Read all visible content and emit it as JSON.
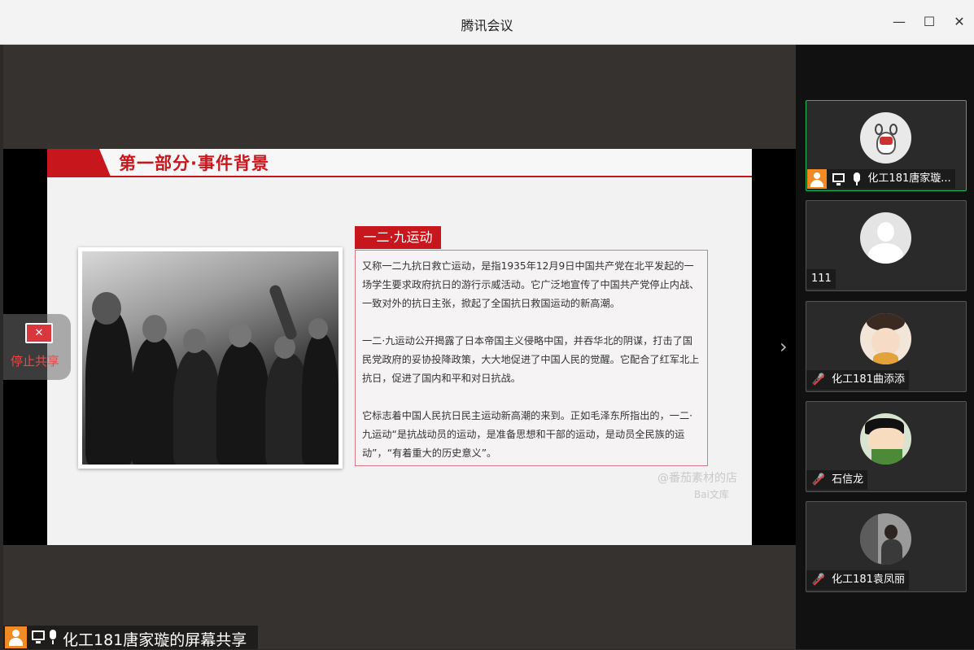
{
  "window": {
    "title": "腾讯会议",
    "minimize_glyph": "—",
    "maximize_glyph": "☐",
    "close_glyph": "✕"
  },
  "slide": {
    "section_title": "第一部分·事件背景",
    "event_label": "一二·九运动",
    "paragraphs": [
      "又称一二九抗日救亡运动，是指1935年12月9日中国共产党在北平发起的一场学生要求政府抗日的游行示威活动。它广泛地宣传了中国共产党停止内战、一致对外的抗日主张，掀起了全国抗日救国运动的新高潮。",
      "一二·九运动公开揭露了日本帝国主义侵略中国，并吞华北的阴谋，打击了国民党政府的妥协投降政策，大大地促进了中国人民的觉醒。它配合了红军北上抗日，促进了国内和平和对日抗战。",
      "它标志着中国人民抗日民主运动新高潮的来到。正如毛泽东所指出的，一二·九运动“是抗战动员的运动，是准备思想和干部的运动，是动员全民族的运动”，“有着重大的历史意义”。"
    ],
    "watermark_shop": "@番茄素材的店",
    "watermark_brand": "Bai文库"
  },
  "controls": {
    "stop_share_label": "停止共享",
    "stop_share_icon": "✕",
    "expand_arrow": "›"
  },
  "presenter_bar": {
    "label": "化工181唐家璇的屏幕共享"
  },
  "participants": [
    {
      "name": "化工181唐家璇...",
      "muted": false,
      "host": true,
      "sharing": true,
      "active": true
    },
    {
      "name": "111",
      "muted": false,
      "host": false,
      "sharing": false,
      "active": false
    },
    {
      "name": "化工181曲添添",
      "muted": true,
      "host": false,
      "sharing": false,
      "active": false
    },
    {
      "name": "石信龙",
      "muted": true,
      "host": false,
      "sharing": false,
      "active": false
    },
    {
      "name": "化工181袁凤丽",
      "muted": true,
      "host": false,
      "sharing": false,
      "active": false
    }
  ],
  "colors": {
    "accent_red": "#c8161d",
    "active_border": "#1fbb5f",
    "host_orange": "#f08a24",
    "stop_red": "#f04848"
  }
}
